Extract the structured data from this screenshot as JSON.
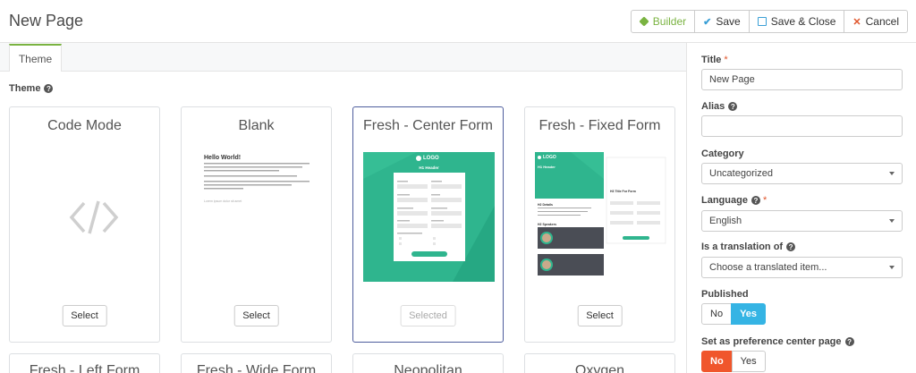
{
  "header": {
    "title": "New Page",
    "buttons": {
      "builder": "Builder",
      "save": "Save",
      "save_close": "Save & Close",
      "cancel": "Cancel"
    }
  },
  "tabs": [
    {
      "label": "Theme"
    }
  ],
  "theme_section": {
    "label": "Theme",
    "cards": [
      {
        "title": "Code Mode",
        "button": "Select"
      },
      {
        "title": "Blank",
        "button": "Select",
        "preview": {
          "heading": "Hello World!",
          "footer": "Lorem ipsum dolor sit amet"
        }
      },
      {
        "title": "Fresh - Center Form",
        "button": "Selected",
        "preview": {
          "logo": "LOGO",
          "header": "H1 Header"
        }
      },
      {
        "title": "Fresh - Fixed Form",
        "button": "Select",
        "preview": {
          "logo": "LOGO",
          "header": "H1 Header",
          "section": "H2 Details",
          "speakers": "H2 Speakers",
          "form_title": "H3 Title For Form"
        }
      },
      {
        "title": "Fresh - Left Form"
      },
      {
        "title": "Fresh - Wide Form"
      },
      {
        "title": "Neopolitan"
      },
      {
        "title": "Oxygen"
      }
    ]
  },
  "sidebar": {
    "title": {
      "label": "Title",
      "required": "*",
      "value": "New Page"
    },
    "alias": {
      "label": "Alias",
      "value": ""
    },
    "category": {
      "label": "Category",
      "value": "Uncategorized"
    },
    "language": {
      "label": "Language",
      "required": "*",
      "value": "English"
    },
    "translation": {
      "label": "Is a translation of",
      "value": "Choose a translated item..."
    },
    "published": {
      "label": "Published",
      "no": "No",
      "yes": "Yes"
    },
    "preference": {
      "label": "Set as preference center page",
      "no": "No",
      "yes": "Yes"
    }
  },
  "colors": {
    "accent_green": "#7ab341",
    "accent_blue": "#35b4e4",
    "accent_red": "#f0562c",
    "theme_teal": "#2fb58e"
  }
}
